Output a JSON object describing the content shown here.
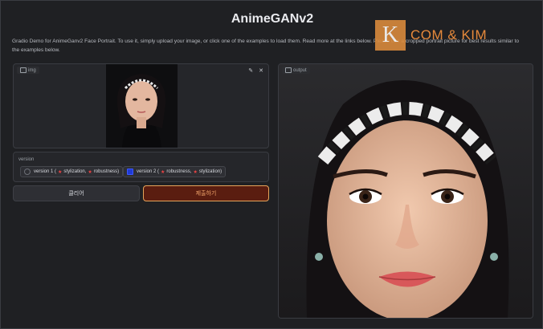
{
  "app": {
    "title": "AnimeGANv2",
    "description": "Gradio Demo for AnimeGanv2 Face Portrait. To use it, simply upload your image, or click one of the examples to load them. Read more at the links below. Please use a cropped portrait picture for best results similar to the examples below."
  },
  "input": {
    "label": "img",
    "edit_icon": "edit-icon",
    "close_icon": "close-icon"
  },
  "output": {
    "label": "output"
  },
  "version": {
    "label": "version",
    "options": [
      {
        "prefix": "version 1 (",
        "a": "stylization,",
        "b": "robustness)",
        "selected": false
      },
      {
        "prefix": "version 2 (",
        "a": "robustness,",
        "b": "stylization)",
        "selected": true
      }
    ]
  },
  "buttons": {
    "clear": "클리어",
    "submit": "제출하기"
  },
  "watermark": {
    "logo": "K",
    "text": "COM & KIM"
  },
  "colors": {
    "submit_border": "#e6a45a",
    "submit_bg": "#5a1d10",
    "selected_radio": "#1f3bd6"
  }
}
